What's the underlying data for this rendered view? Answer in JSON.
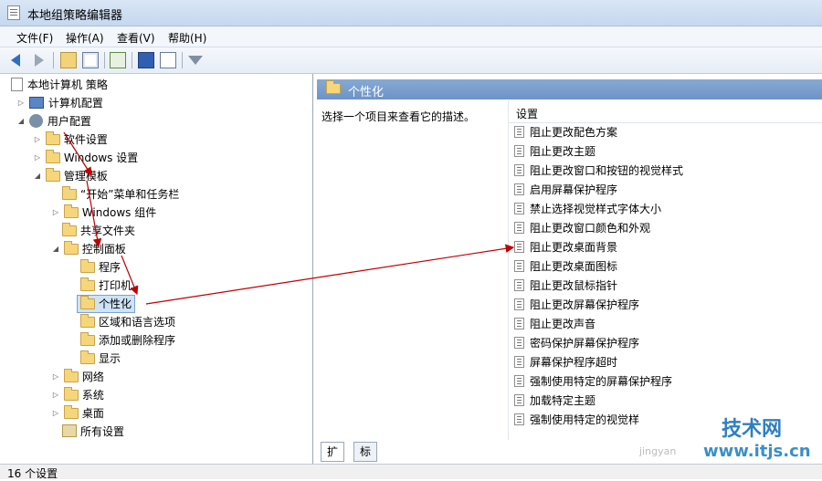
{
  "window": {
    "title": "本地组策略编辑器"
  },
  "menu": [
    {
      "label": "文件(F)"
    },
    {
      "label": "操作(A)"
    },
    {
      "label": "查看(V)"
    },
    {
      "label": "帮助(H)"
    }
  ],
  "toolbar": {
    "icons": [
      "back-arrow-icon",
      "forward-arrow-icon",
      "up-folder-icon",
      "show-hide-tree-icon",
      "export-list-icon",
      "help-icon",
      "properties-icon",
      "filter-icon"
    ]
  },
  "tree": {
    "root": "本地计算机 策略",
    "computer_config": "计算机配置",
    "user_config": "用户配置",
    "software_settings": "软件设置",
    "windows_settings": "Windows 设置",
    "admin_templates": "管理模板",
    "start_menu": "“开始”菜单和任务栏",
    "windows_components": "Windows 组件",
    "shared_folders": "共享文件夹",
    "control_panel": "控制面板",
    "programs": "程序",
    "printers": "打印机",
    "personalization": "个性化",
    "region_language": "区域和语言选项",
    "add_remove": "添加或删除程序",
    "display": "显示",
    "network": "网络",
    "system": "系统",
    "desktop": "桌面",
    "all_settings": "所有设置"
  },
  "right": {
    "header": "个性化",
    "description": "选择一个项目来查看它的描述。",
    "column_header": "设置",
    "settings": [
      "阻止更改配色方案",
      "阻止更改主题",
      "阻止更改窗口和按钮的视觉样式",
      "启用屏幕保护程序",
      "禁止选择视觉样式字体大小",
      "阻止更改窗口颜色和外观",
      "阻止更改桌面背景",
      "阻止更改桌面图标",
      "阻止更改鼠标指针",
      "阻止更改屏幕保护程序",
      "阻止更改声音",
      "密码保护屏幕保护程序",
      "屏幕保护程序超时",
      "强制使用特定的屏幕保护程序",
      "加载特定主题",
      "强制使用特定的视觉样"
    ]
  },
  "tabs": [
    "扩展",
    "标准"
  ],
  "status": "16 个设置",
  "watermark": {
    "site": "www.itjs.cn",
    "brand": "技术网",
    "sub": "jingyan"
  },
  "colors": {
    "header": "#7399c9",
    "selection": "#cde3f7",
    "annotation": "#c00000"
  }
}
